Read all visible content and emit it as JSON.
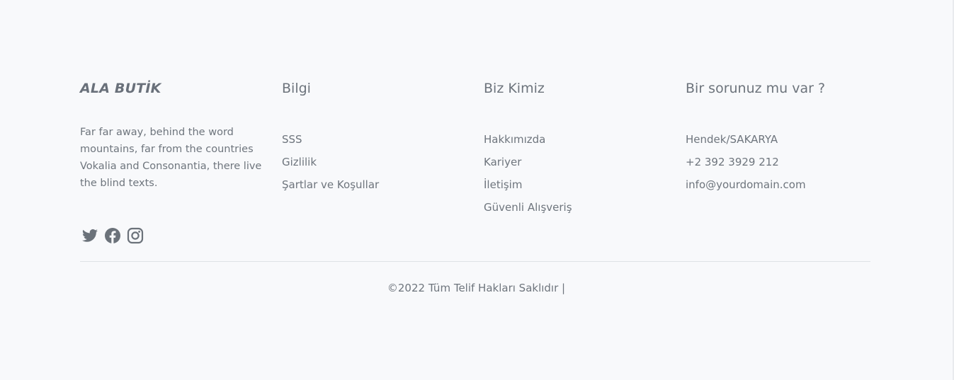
{
  "footer": {
    "brand": "ALA BUTİK",
    "description": "Far far away, behind the word mountains, far from the countries Vokalia and Consonantia, there live the blind texts.",
    "social": [
      {
        "icon": "twitter-icon"
      },
      {
        "icon": "facebook-icon"
      },
      {
        "icon": "instagram-icon"
      }
    ],
    "columns": [
      {
        "heading": "Bilgi",
        "links": [
          "SSS",
          "Gizlilik",
          "Şartlar ve Koşullar"
        ]
      },
      {
        "heading": "Biz Kimiz",
        "links": [
          "Hakkımızda",
          "Kariyer",
          "İletişim",
          "Güvenli Alışveriş"
        ]
      },
      {
        "heading": "Bir sorunuz mu var ?",
        "links": [
          "Hendek/SAKARYA",
          "+2 392 3929 212",
          "info@yourdomain.com"
        ]
      }
    ],
    "copyright": "©2022 Tüm Telif Hakları Saklıdır |"
  },
  "colors": {
    "background": "#f8f9fb",
    "text": "#6e757d",
    "icon": "#6b727a",
    "divider": "#dfe2e6"
  }
}
